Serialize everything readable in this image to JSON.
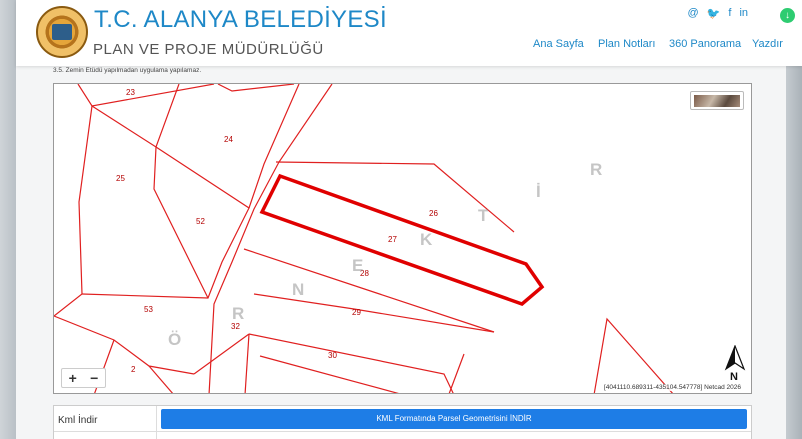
{
  "header": {
    "title": "T.C. ALANYA BELEDİYESİ",
    "subtitle": "PLAN VE PROJE MÜDÜRLÜĞÜ",
    "social": [
      "@",
      "🐦",
      "f",
      "in"
    ],
    "nav": [
      "Ana Sayfa",
      "Plan Notları",
      "360 Panorama",
      "Yazdır"
    ]
  },
  "note": "3.5. Zemin Etüdü yapılmadan uygulama yapılamaz.",
  "map": {
    "parcels": [
      "23",
      "24",
      "25",
      "52",
      "53",
      "32",
      "2",
      "26",
      "27",
      "28",
      "29",
      "30"
    ],
    "watermark_letters": [
      "Ö",
      "R",
      "N",
      "E",
      "K",
      "T",
      "İ",
      "R"
    ],
    "zoom_in": "+",
    "zoom_out": "−",
    "coords": "[4041110.689311-435104.547778] Netcad 2026",
    "north_label": "N",
    "colors": {
      "parcel_line": "#e02020",
      "highlight": "#e00000"
    }
  },
  "table": {
    "rows": [
      {
        "label": "Kml İndir",
        "button": "KML Formatında Parsel Geometrisini İNDİR"
      }
    ]
  }
}
